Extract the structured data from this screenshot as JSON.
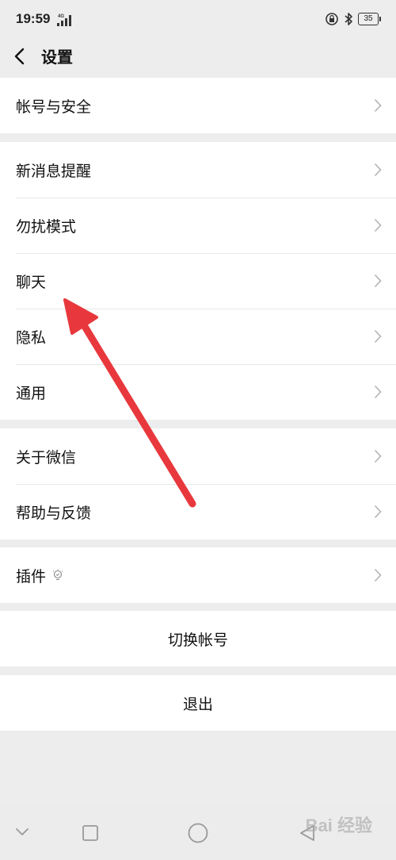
{
  "status_bar": {
    "time": "19:59",
    "network": "4G",
    "battery": "35",
    "icons": [
      "signal-icon",
      "alarm-lock-icon",
      "bluetooth-icon",
      "battery-icon"
    ]
  },
  "header": {
    "title": "设置",
    "back_icon": "back-chevron-icon"
  },
  "groups": [
    {
      "items": [
        {
          "label": "帐号与安全"
        }
      ]
    },
    {
      "items": [
        {
          "label": "新消息提醒"
        },
        {
          "label": "勿扰模式"
        },
        {
          "label": "聊天"
        },
        {
          "label": "隐私"
        },
        {
          "label": "通用"
        }
      ]
    },
    {
      "items": [
        {
          "label": "关于微信"
        },
        {
          "label": "帮助与反馈"
        }
      ]
    },
    {
      "items": [
        {
          "label": "插件",
          "badge_icon": "plugin-bulb-icon"
        }
      ]
    }
  ],
  "actions": {
    "switch_account": "切换帐号",
    "logout": "退出"
  },
  "bottom_nav": {
    "icons": [
      "nav-down-icon",
      "nav-recent-icon",
      "nav-home-icon",
      "nav-back-icon"
    ]
  },
  "overlay": {
    "arrow_color": "#e8383d",
    "watermark": "Bai 经验"
  },
  "colors": {
    "background": "#ededed",
    "card": "#ffffff",
    "divider": "#e8e8e8",
    "chevron": "#b2b2b2"
  }
}
